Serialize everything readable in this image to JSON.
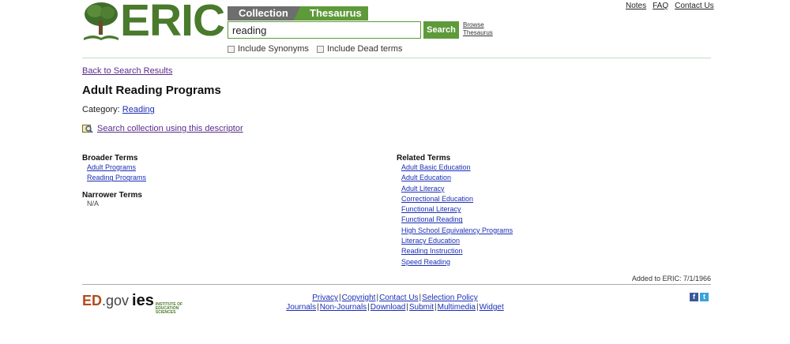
{
  "header": {
    "logo_text": "ERIC",
    "tabs": {
      "collection": "Collection",
      "thesaurus": "Thesaurus"
    },
    "search_value": "reading",
    "search_button": "Search",
    "browse_line1": "Browse",
    "browse_line2": "Thesaurus",
    "checkboxes": {
      "synonyms": "Include Synonyms",
      "dead_terms": "Include Dead terms"
    },
    "top_links": {
      "notes": "Notes",
      "faq": "FAQ",
      "contact": "Contact Us"
    }
  },
  "main": {
    "back_link": "Back to Search Results",
    "title": "Adult Reading Programs",
    "category_label": "Category:",
    "category_value": "Reading",
    "search_descriptor": "Search collection using this descriptor",
    "broader_heading": "Broader Terms",
    "broader_terms": [
      "Adult Programs",
      "Reading Programs"
    ],
    "narrower_heading": "Narrower Terms",
    "narrower_value": "N/A",
    "related_heading": "Related Terms",
    "related_terms": [
      "Adult Basic Education",
      "Adult Education",
      "Adult Literacy",
      "Correctional Education",
      "Functional Literacy",
      "Functional Reading",
      "High School Equivalency Programs",
      "Literacy Education",
      "Reading Instruction",
      "Speed Reading"
    ],
    "added": "Added to ERIC: 7/1/1966"
  },
  "footer": {
    "ed": "ED",
    "gov": ".gov",
    "ies": "ies",
    "ies_sub": "INSTITUTE OF EDUCATION SCIENCES",
    "row1": [
      "Privacy",
      "Copyright",
      "Contact Us",
      "Selection Policy"
    ],
    "row2": [
      "Journals",
      "Non-Journals",
      "Download",
      "Submit",
      "Multimedia",
      "Widget"
    ],
    "facebook": "f",
    "twitter": "t"
  },
  "colors": {
    "brand_green": "#5e9a3a",
    "tab_gray": "#6e6e6e",
    "link_blue": "#1a2fb5",
    "visited_purple": "#5b2b8c"
  }
}
